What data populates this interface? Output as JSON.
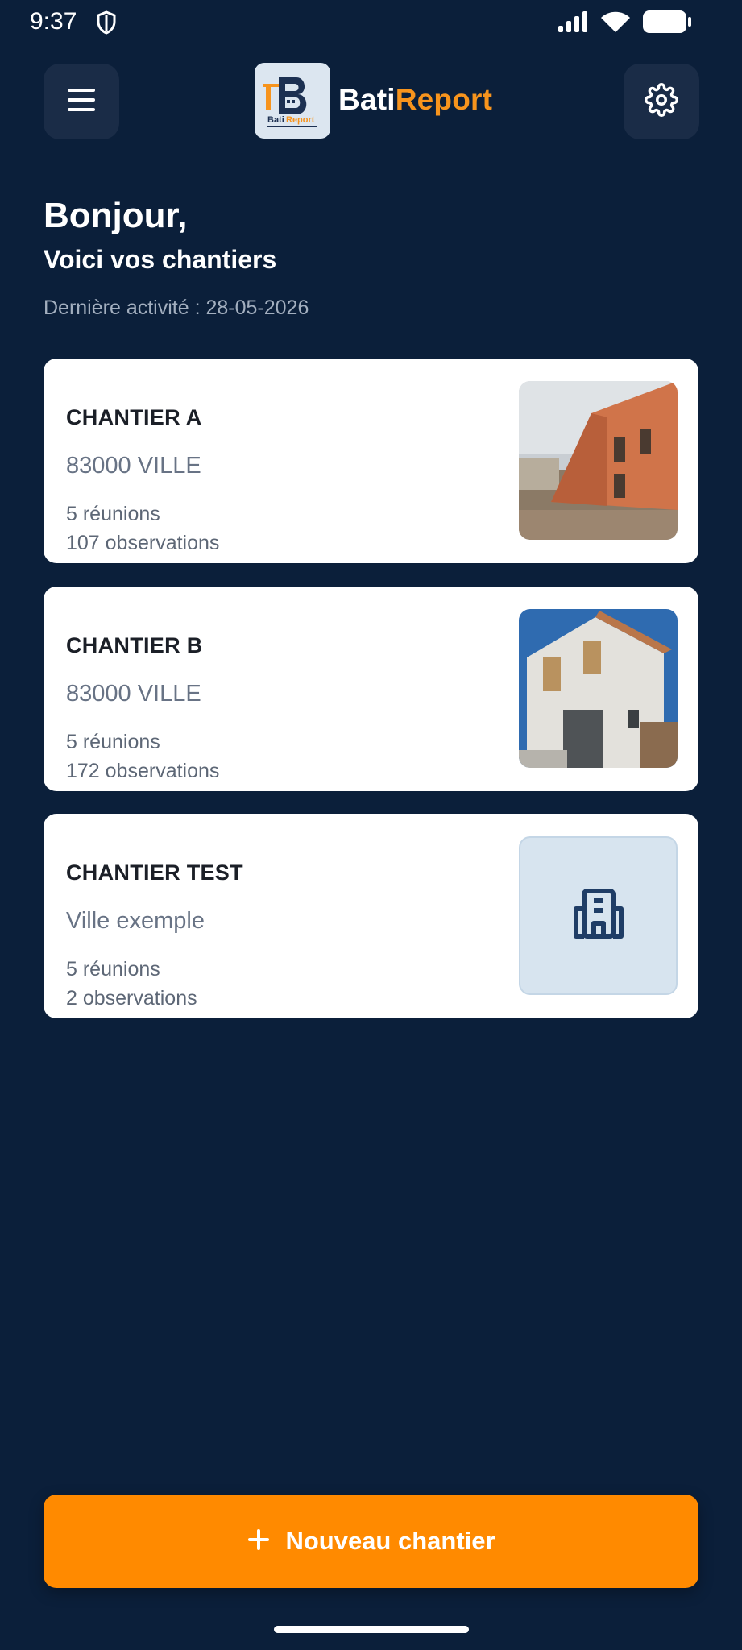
{
  "status_bar": {
    "time": "9:37",
    "icons": [
      "shield-icon",
      "signal-icon",
      "wifi-icon",
      "battery-icon"
    ]
  },
  "header": {
    "menu_icon": "hamburger-menu-icon",
    "brand_part1": "Bati",
    "brand_part2": "Report",
    "logo_text_1": "Bati",
    "logo_text_2": "Report",
    "settings_icon": "gear-icon"
  },
  "main": {
    "greeting": "Bonjour,",
    "subtitle": "Voici vos chantiers",
    "last_activity": "Dernière activité : 28-05-2026"
  },
  "projects": [
    {
      "name": "CHANTIER A",
      "city": "83000 VILLE",
      "meetings": "5 réunions",
      "observations": "107 observations",
      "thumbnail": "photo-brick-construction"
    },
    {
      "name": "CHANTIER B",
      "city": "83000 VILLE",
      "meetings": "5 réunions",
      "observations": "172 observations",
      "thumbnail": "photo-finished-house"
    },
    {
      "name": "CHANTIER TEST",
      "city": "Ville exemple",
      "meetings": "5 réunions",
      "observations": "2 observations",
      "thumbnail": "building-icon"
    }
  ],
  "actions": {
    "new_project_label": "Nouveau chantier",
    "new_project_icon": "plus-icon"
  },
  "colors": {
    "background": "#0b1f3a",
    "accent": "#ff8a00",
    "brand_orange": "#f7941d",
    "card": "#ffffff"
  }
}
